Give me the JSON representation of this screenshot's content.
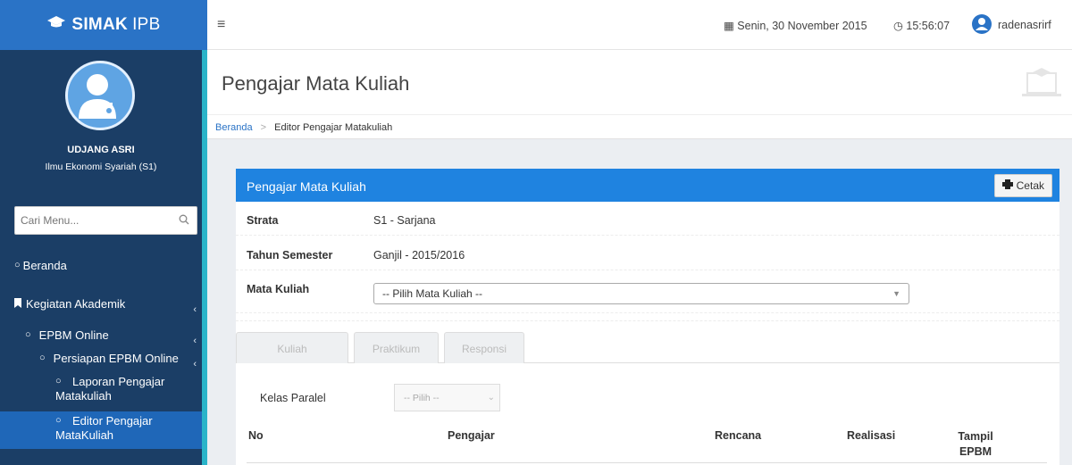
{
  "brand": {
    "name": "SIMAK",
    "suffix": "IPB"
  },
  "user": {
    "name": "UDJANG ASRI",
    "program": "Ilmu Ekonomi Syariah (S1)"
  },
  "search": {
    "placeholder": "Cari Menu..."
  },
  "menu": [
    {
      "label": "Beranda"
    },
    {
      "label": "Kegiatan Akademik"
    },
    {
      "label": "EPBM Online"
    },
    {
      "label": "Persiapan EPBM Online"
    },
    {
      "label": "Laporan Pengajar Matakuliah"
    },
    {
      "label": "Editor Pengajar MataKuliah"
    }
  ],
  "topbar": {
    "date": "Senin, 30 November 2015",
    "time": "15:56:07",
    "username": "radenasrirf"
  },
  "page": {
    "title": "Pengajar Mata Kuliah"
  },
  "breadcrumb": {
    "home": "Beranda",
    "current": "Editor Pengajar Matakuliah"
  },
  "panel": {
    "title": "Pengajar Mata Kuliah",
    "print_label": "Cetak",
    "strata_label": "Strata",
    "strata_value": "S1 - Sarjana",
    "semester_label": "Tahun Semester",
    "semester_value": "Ganjil - 2015/2016",
    "matkul_label": "Mata Kuliah",
    "matkul_placeholder": "-- Pilih Mata Kuliah --"
  },
  "tabs": [
    {
      "label": "Kuliah"
    },
    {
      "label": "Praktikum"
    },
    {
      "label": "Responsi"
    }
  ],
  "kelas": {
    "label": "Kelas Paralel",
    "placeholder": "-- Pilih --"
  },
  "table": {
    "columns": [
      "No",
      "Pengajar",
      "Rencana",
      "Realisasi",
      "Tampil EPBM"
    ]
  },
  "colors": {
    "sidebar": "#1b3e66",
    "brand_bar": "#2a73c6",
    "panel_header": "#1f83e0",
    "accent": "#2ab4c9",
    "active_item": "#1f67b8"
  }
}
